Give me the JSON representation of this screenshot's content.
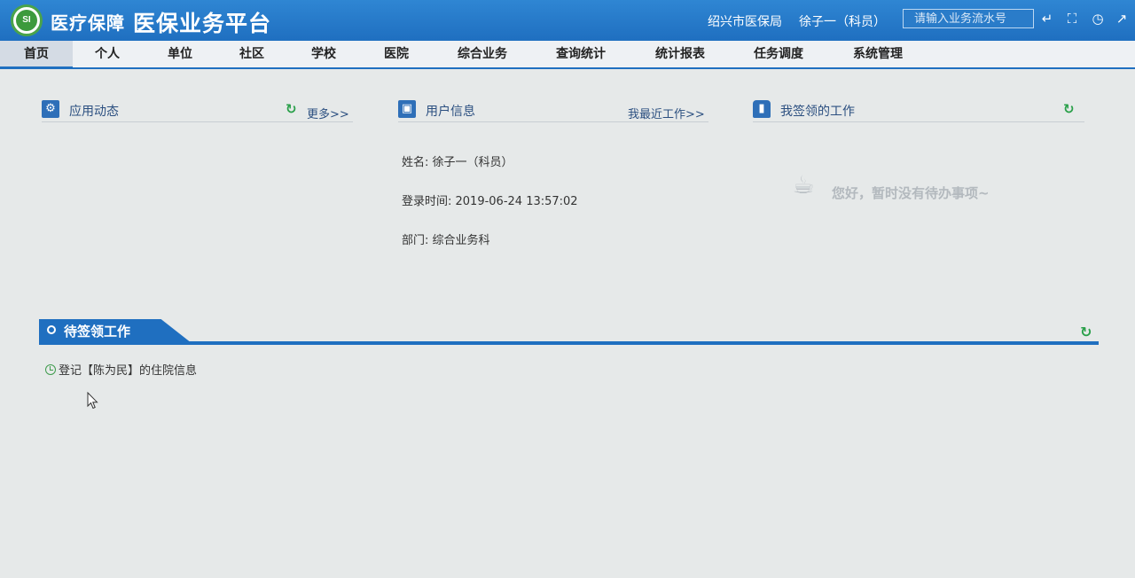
{
  "header": {
    "logo_text": "SI",
    "brand_small": "医疗保障",
    "brand_big": "医保业务平台",
    "org": "绍兴市医保局",
    "user": "徐子一（科员）",
    "search_placeholder": "请输入业务流水号"
  },
  "nav": [
    "首页",
    "个人",
    "单位",
    "社区",
    "学校",
    "医院",
    "综合业务",
    "查询统计",
    "统计报表",
    "任务调度",
    "系统管理"
  ],
  "panels": {
    "app": {
      "title": "应用动态",
      "more": "更多>>"
    },
    "user": {
      "title": "用户信息",
      "recent": "我最近工作>>",
      "name": "姓名: 徐子一（科员）",
      "login": "登录时间: 2019-06-24 13:57:02",
      "dept": "部门: 综合业务科"
    },
    "claimed": {
      "title": "我签领的工作",
      "empty": "您好，暂时没有待办事项~"
    }
  },
  "pending": {
    "title": "待签领工作",
    "items": [
      "登记【陈为民】的住院信息"
    ]
  },
  "colors": {
    "primary": "#1f6fc0",
    "refresh": "#2aa04a",
    "background": "#e6e9e9"
  }
}
